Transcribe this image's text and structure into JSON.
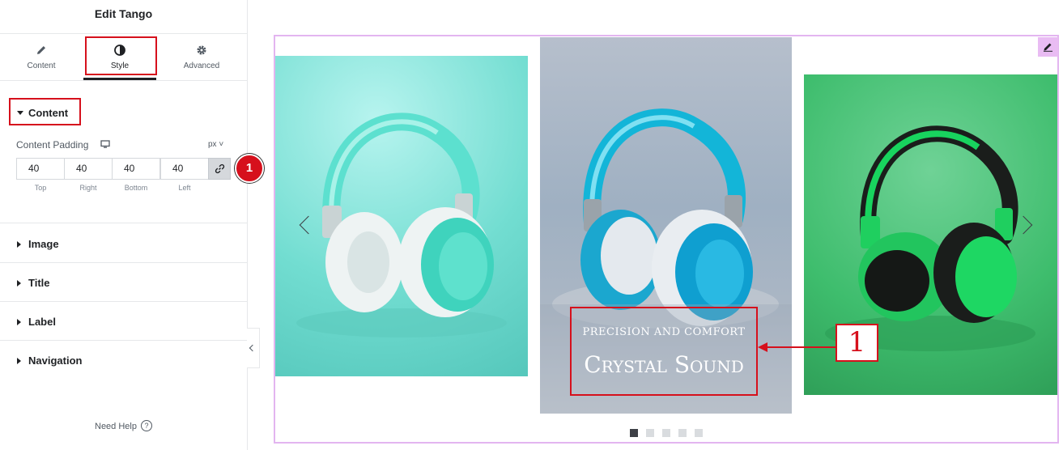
{
  "panel": {
    "title": "Edit Tango",
    "tabs": [
      {
        "label": "Content",
        "icon": "pencil-icon"
      },
      {
        "label": "Style",
        "icon": "half-circle-icon"
      },
      {
        "label": "Advanced",
        "icon": "gear-icon"
      }
    ],
    "active_tab": "Style",
    "content_section": {
      "title": "Content",
      "padding_label": "Content Padding",
      "device_icon": "monitor-icon",
      "unit": "px",
      "values": [
        "40",
        "40",
        "40",
        "40"
      ],
      "captions": [
        "Top",
        "Right",
        "Bottom",
        "Left"
      ],
      "link_icon": "link-icon"
    },
    "sections": [
      "Image",
      "Title",
      "Label",
      "Navigation"
    ],
    "need_help": "Need Help",
    "help_icon": "help-icon",
    "step_badge": "1"
  },
  "canvas": {
    "edit_icon": "pencil-icon",
    "slides": [
      {
        "name": "teal-headphones"
      },
      {
        "name": "blue-headphones",
        "subtitle": "PRECISION AND COMFORT",
        "title": "Crystal Sound"
      },
      {
        "name": "green-headphones"
      }
    ],
    "callout_number": "1",
    "dots": [
      true,
      false,
      false,
      false,
      false
    ]
  },
  "colors": {
    "accent_red": "#d6101c",
    "selection_border": "#e3b5f0",
    "text_dark": "#1f2124"
  }
}
